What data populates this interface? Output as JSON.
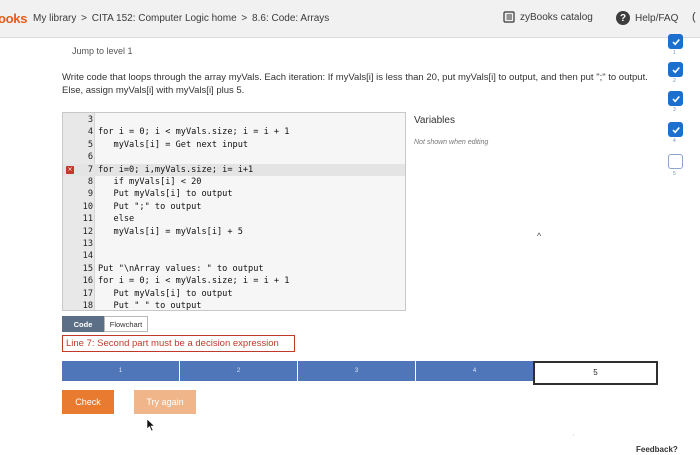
{
  "header": {
    "brand": "ooks",
    "crumbs": [
      "My library",
      "CITA 152: Computer Logic home",
      "8.6: Code: Arrays"
    ],
    "catalog_label": "zyBooks catalog",
    "help_label": "Help/FAQ",
    "edge_char": "("
  },
  "activity": {
    "jump_label": "Jump to level 1",
    "prompt": "Write code that loops through the array myVals. Each iteration: If myVals[i] is less than 20, put myVals[i] to output, and then put \";\" to output. Else, assign myVals[i] with myVals[i] plus 5."
  },
  "editor": {
    "lines": [
      {
        "num": "3",
        "text": ""
      },
      {
        "num": "4",
        "text": "for i = 0; i < myVals.size; i = i + 1"
      },
      {
        "num": "5",
        "text": "   myVals[i] = Get next input"
      },
      {
        "num": "6",
        "text": ""
      },
      {
        "num": "7",
        "text": "for i=0; i,myVals.size; i= i+1"
      },
      {
        "num": "8",
        "text": "   if myVals[i] < 20"
      },
      {
        "num": "9",
        "text": "   Put myVals[i] to output"
      },
      {
        "num": "10",
        "text": "   Put \";\" to output"
      },
      {
        "num": "11",
        "text": "   else"
      },
      {
        "num": "12",
        "text": "   myVals[i] = myVals[i] + 5"
      },
      {
        "num": "13",
        "text": ""
      },
      {
        "num": "14",
        "text": ""
      },
      {
        "num": "15",
        "text": "Put \"\\nArray values: \" to output"
      },
      {
        "num": "16",
        "text": "for i = 0; i < myVals.size; i = i + 1"
      },
      {
        "num": "17",
        "text": "   Put myVals[i] to output"
      },
      {
        "num": "18",
        "text": "   Put \" \" to output"
      }
    ],
    "active_line": "7"
  },
  "variables": {
    "title": "Variables",
    "note": "Not shown when editing"
  },
  "tabs": {
    "code": "Code",
    "flowchart": "Flowchart"
  },
  "error_message": "Line 7: Second part must be a decision expression",
  "progress": {
    "segments": [
      "1",
      "2",
      "3",
      "4"
    ],
    "current": "5"
  },
  "buttons": {
    "check": "Check",
    "try_again": "Try again"
  },
  "feedback_label": "Feedback?",
  "levels": [
    {
      "num": "1",
      "state": "done"
    },
    {
      "num": "2",
      "state": "done"
    },
    {
      "num": "3",
      "state": "done"
    },
    {
      "num": "4",
      "state": "done"
    },
    {
      "num": "5",
      "state": "current"
    }
  ],
  "colors": {
    "accent": "#e87b2f",
    "progress": "#4f76b8",
    "error": "#c0392b",
    "level_done": "#1c6fcf"
  }
}
